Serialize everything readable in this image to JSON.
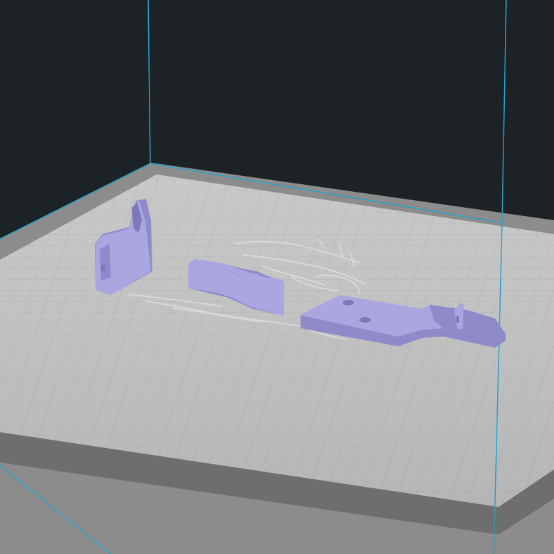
{
  "app": {
    "view": "3d-print-preview"
  },
  "scene": {
    "background_color": "#1c2226",
    "build_volume_edge_color": "#29a3c9",
    "bed": {
      "top_color": "#c5c5c5",
      "grid_line_color": "#aeaeae",
      "rim_color": "#8c8c8c",
      "rim_shadow_color": "#6e6e6e"
    },
    "model_color": "#a9a6e0",
    "model_shade_color": "#8f8bcb",
    "model_dark_color": "#7d79b8",
    "models": [
      {
        "id": "bracket-upright"
      },
      {
        "id": "curved-bar"
      },
      {
        "id": "mounting-plate"
      }
    ],
    "support_outlines": {
      "color": "#e0e0e0"
    }
  }
}
